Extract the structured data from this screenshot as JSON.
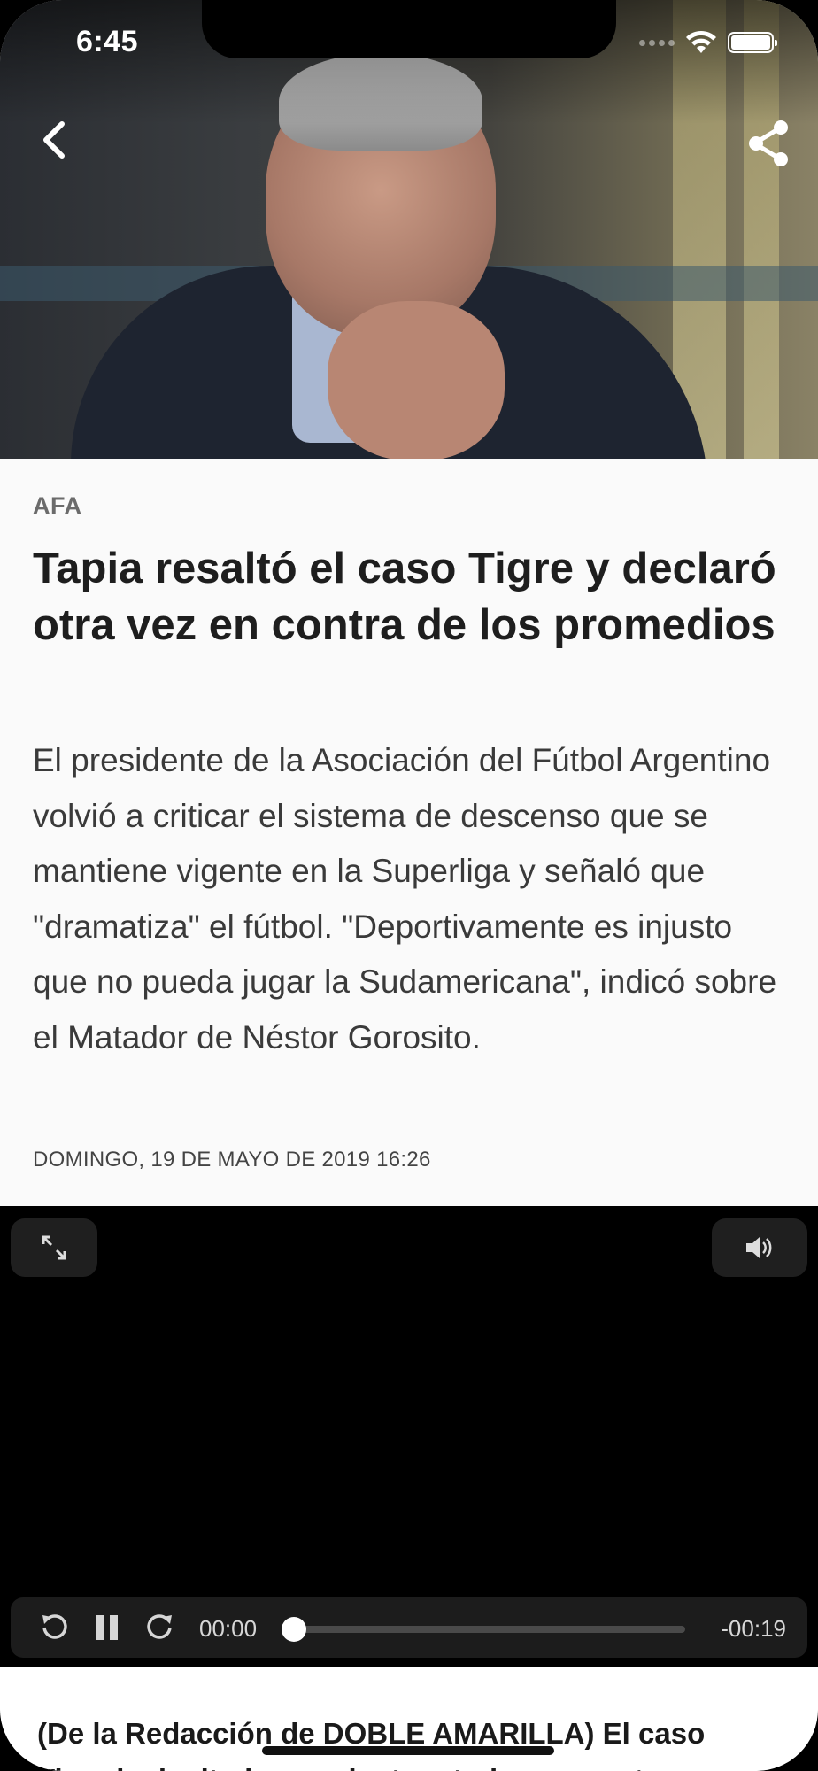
{
  "status_bar": {
    "time": "6:45"
  },
  "header": {
    "back_icon": "chevron-left-icon",
    "share_icon": "share-icon"
  },
  "article": {
    "section": "AFA",
    "title": "Tapia resaltó el caso Tigre y declaró otra vez en contra de los promedios",
    "summary": "El presidente de la Asociación del Fútbol Argentino volvió a criticar el sistema de descenso que se mantiene vigente en la Superliga y señaló que \"dramatiza\" el fútbol. \"Deportivamente es injusto que no pueda jugar la Sudamericana\", indicó sobre el Matador de Néstor Gorosito.",
    "date": "DOMINGO, 19 DE MAYO DE 2019 16:26",
    "body_start": "(De la Redacción de DOBLE AMARILLA) El caso Tigre ha invitado a replantear todo en cuanto a"
  },
  "video_player": {
    "current_time": "00:00",
    "remaining_time": "-00:19",
    "progress": 0,
    "icons": [
      "expand-icon",
      "volume-icon",
      "rewind-icon",
      "pause-icon",
      "forward-icon"
    ]
  },
  "colors": {
    "background": "#fafafa",
    "title": "#1e1e1e",
    "section": "#6b6b6b",
    "player_bar": "#1c1c1c"
  }
}
